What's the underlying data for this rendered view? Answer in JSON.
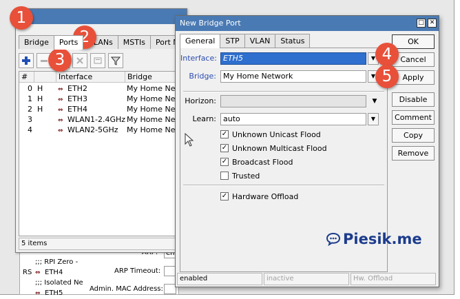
{
  "bridge_window": {
    "tabs": [
      "Bridge",
      "Ports",
      "VLANs",
      "MSTIs",
      "Port MST O"
    ],
    "active_tab": 1,
    "columns": [
      "#",
      "",
      "Interface",
      "Bridge"
    ],
    "rows": [
      {
        "num": "0",
        "flag": "H",
        "interface": "ETH2",
        "bridge": "My Home Netw"
      },
      {
        "num": "1",
        "flag": "H",
        "interface": "ETH3",
        "bridge": "My Home Netw"
      },
      {
        "num": "2",
        "flag": "H",
        "interface": "ETH4",
        "bridge": "My Home Netw"
      },
      {
        "num": "3",
        "flag": "",
        "interface": "WLAN1-2.4GHz",
        "bridge": "My Home Netw"
      },
      {
        "num": "4",
        "flag": "",
        "interface": "WLAN2-5GHz",
        "bridge": "My Home Netw"
      }
    ],
    "status": "5 items"
  },
  "background": {
    "rows": [
      {
        "prefix": "",
        "text": ";;; RPI Zero -"
      },
      {
        "prefix": "RS",
        "text": "ETH4"
      },
      {
        "prefix": "",
        "text": ";;; Isolated Ne"
      },
      {
        "prefix": "",
        "text": "ETH5"
      }
    ],
    "arp_label": "ARP:",
    "arp_value": "ena",
    "arp_timeout_label": "ARP Timeout:",
    "admin_mac_label": "Admin. MAC Address:"
  },
  "dialog": {
    "title": "New Bridge Port",
    "tabs": [
      "General",
      "STP",
      "VLAN",
      "Status"
    ],
    "active_tab": 0,
    "interface_label": "Interface:",
    "interface_value": "ETH5",
    "bridge_label": "Bridge:",
    "bridge_value": "My Home Network",
    "horizon_label": "Horizon:",
    "horizon_value": "",
    "learn_label": "Learn:",
    "learn_value": "auto",
    "checkboxes": [
      {
        "label": "Unknown Unicast Flood",
        "checked": true
      },
      {
        "label": "Unknown Multicast Flood",
        "checked": true
      },
      {
        "label": "Broadcast Flood",
        "checked": true
      },
      {
        "label": "Trusted",
        "checked": false
      }
    ],
    "hardware_offload": {
      "label": "Hardware Offload",
      "checked": true
    },
    "buttons": [
      "OK",
      "Cancel",
      "Apply",
      "Disable",
      "Comment",
      "Copy",
      "Remove"
    ],
    "status": [
      "enabled",
      "inactive",
      "Hw. Offload"
    ]
  },
  "badges": [
    "1",
    "2",
    "3",
    "4",
    "5"
  ],
  "watermark": {
    "text": "Piesik.me",
    "icon": "chat-bubble-icon"
  },
  "icons": {
    "add": "plus-icon",
    "remove": "minus-icon",
    "enable": "check-icon",
    "disable": "x-icon",
    "comment": "note-icon",
    "filter": "filter-icon",
    "interface": "ethernet-arrows-icon",
    "dropdown": "triangle-down-icon"
  },
  "colors": {
    "title_bar": "#4a7ab3",
    "selection": "#2f6fce",
    "badge": "#e8503a",
    "label_blue": "#2b4bb0",
    "watermark": "#1c3c8c"
  }
}
